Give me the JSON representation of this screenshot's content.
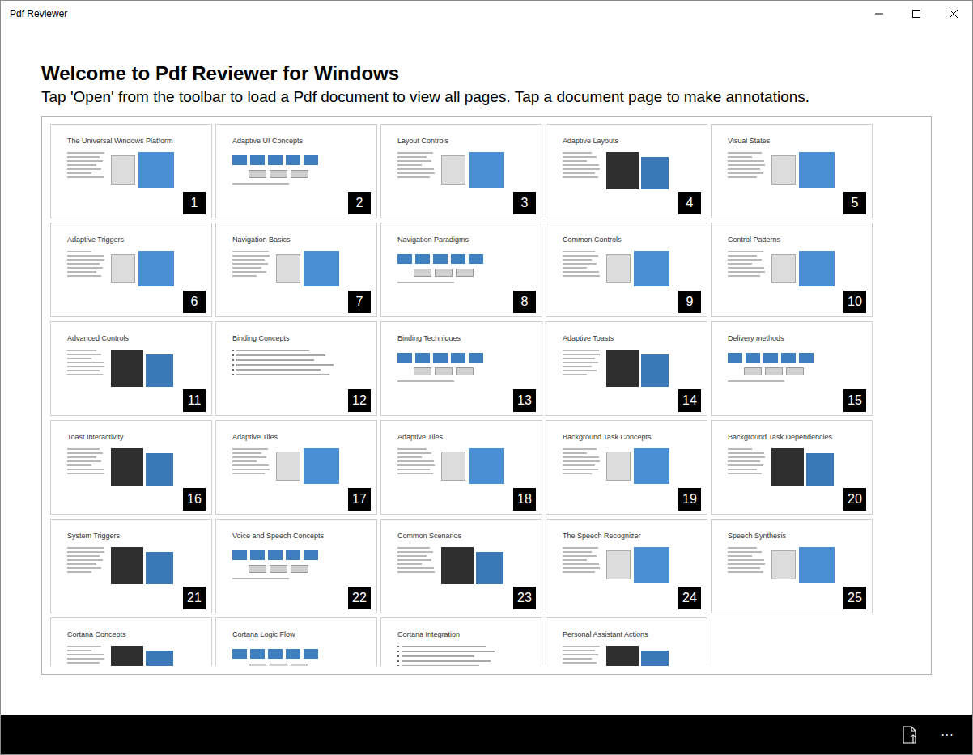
{
  "window": {
    "title": "Pdf Reviewer"
  },
  "heading": "Welcome to Pdf Reviewer for Windows",
  "subtitle": "Tap 'Open' from the toolbar to load a Pdf document to view all pages. Tap a document page to make annotations.",
  "pages": [
    {
      "title": "The Universal Windows Platform",
      "number": "1",
      "kind": "figure"
    },
    {
      "title": "Adaptive UI Concepts",
      "number": "2",
      "kind": "wide"
    },
    {
      "title": "Layout Controls",
      "number": "3",
      "kind": "figure"
    },
    {
      "title": "Adaptive Layouts",
      "number": "4",
      "kind": "dark"
    },
    {
      "title": "Visual States",
      "number": "5",
      "kind": "figure"
    },
    {
      "title": "Adaptive Triggers",
      "number": "6",
      "kind": "figure"
    },
    {
      "title": "Navigation Basics",
      "number": "7",
      "kind": "figure"
    },
    {
      "title": "Navigation Paradigms",
      "number": "8",
      "kind": "wide"
    },
    {
      "title": "Common Controls",
      "number": "9",
      "kind": "figure"
    },
    {
      "title": "Control Patterns",
      "number": "10",
      "kind": "figure"
    },
    {
      "title": "Advanced Controls",
      "number": "11",
      "kind": "dark"
    },
    {
      "title": "Binding Concepts",
      "number": "12",
      "kind": "bullets"
    },
    {
      "title": "Binding Techniques",
      "number": "13",
      "kind": "wide"
    },
    {
      "title": "Adaptive Toasts",
      "number": "14",
      "kind": "dark"
    },
    {
      "title": "Delivery methods",
      "number": "15",
      "kind": "wide"
    },
    {
      "title": "Toast Interactivity",
      "number": "16",
      "kind": "dark"
    },
    {
      "title": "Adaptive Tiles",
      "number": "17",
      "kind": "figure"
    },
    {
      "title": "Adaptive Tiles",
      "number": "18",
      "kind": "figure"
    },
    {
      "title": "Background Task Concepts",
      "number": "19",
      "kind": "figure"
    },
    {
      "title": "Background Task Dependencies",
      "number": "20",
      "kind": "dark"
    },
    {
      "title": "System Triggers",
      "number": "21",
      "kind": "dark"
    },
    {
      "title": "Voice and Speech Concepts",
      "number": "22",
      "kind": "wide"
    },
    {
      "title": "Common Scenarios",
      "number": "23",
      "kind": "dark"
    },
    {
      "title": "The Speech Recognizer",
      "number": "24",
      "kind": "figure"
    },
    {
      "title": "Speech Synthesis",
      "number": "25",
      "kind": "figure"
    },
    {
      "title": "Cortana Concepts",
      "kind": "dark"
    },
    {
      "title": "Cortana Logic Flow",
      "kind": "wide"
    },
    {
      "title": "Cortana Integration",
      "kind": "bullets"
    },
    {
      "title": "Personal Assistant Actions",
      "kind": "dark"
    }
  ],
  "toolbar": {
    "more": "···"
  }
}
